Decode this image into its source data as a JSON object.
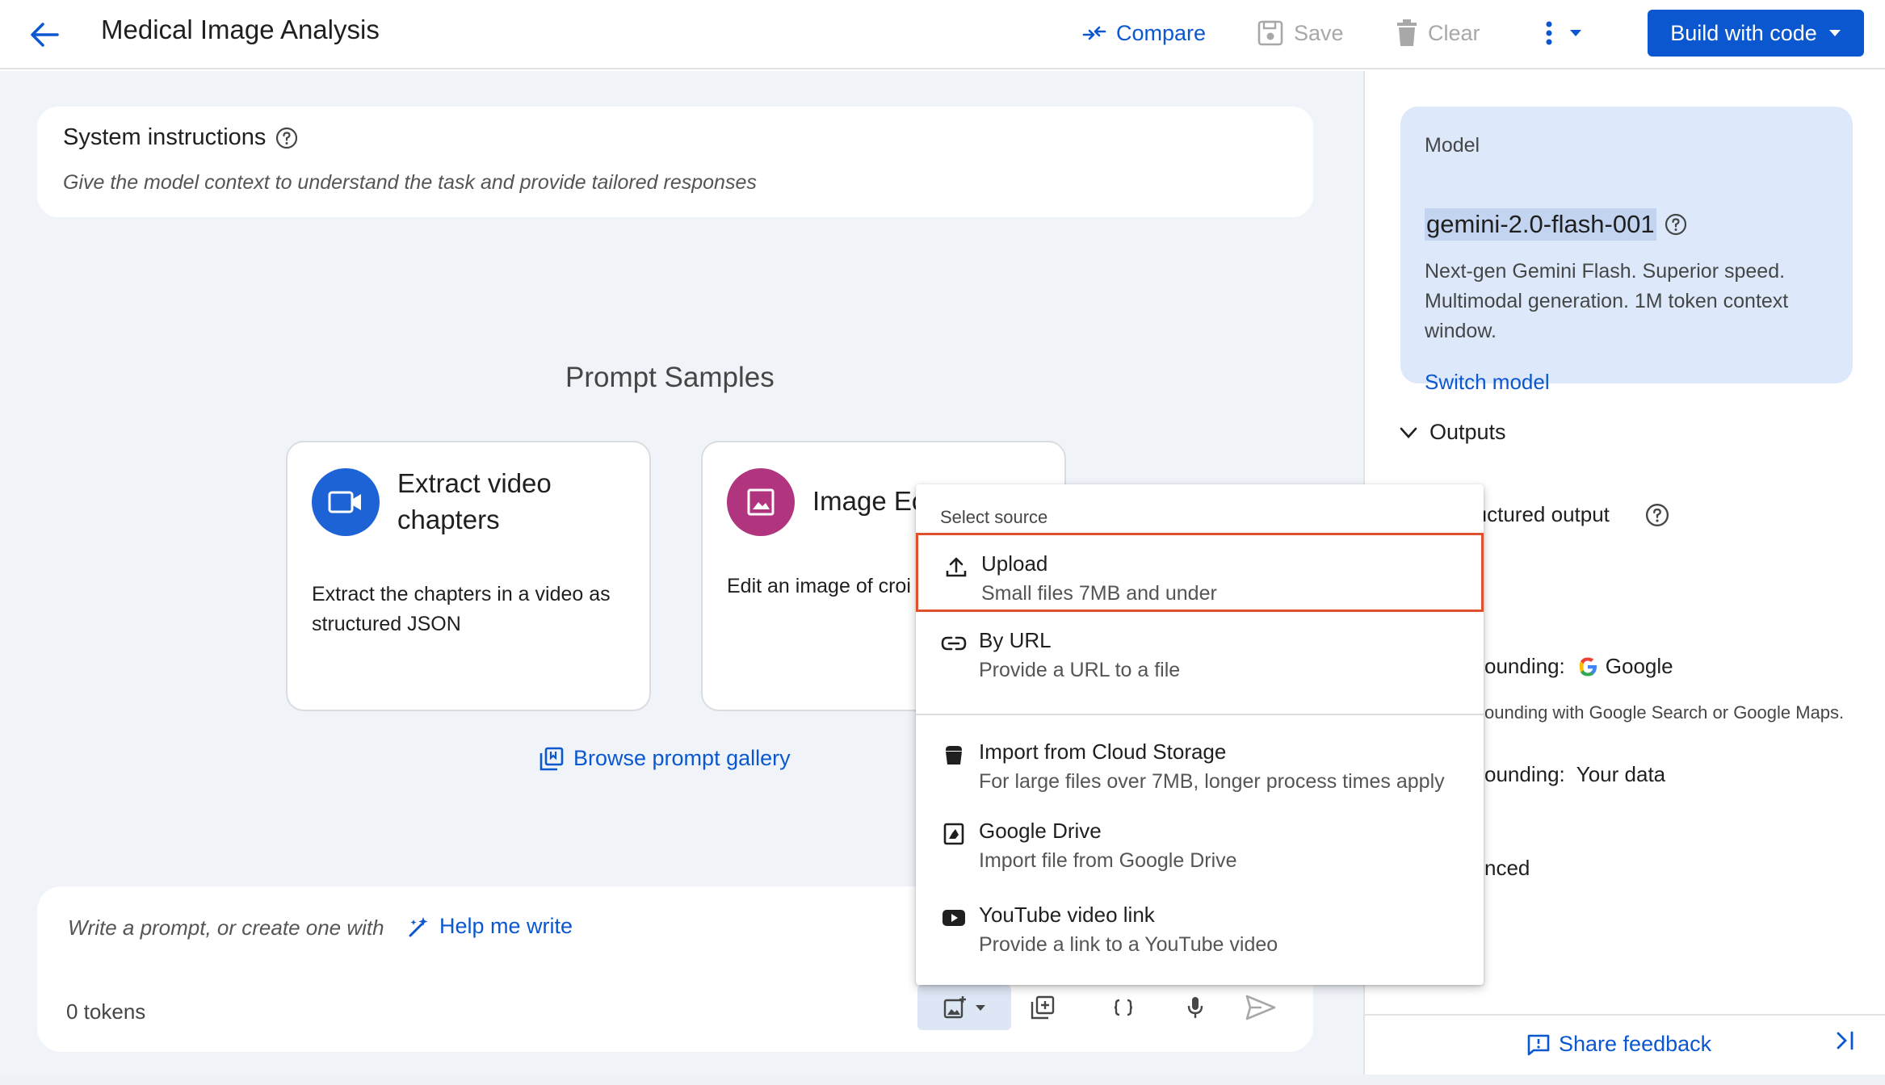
{
  "header": {
    "title": "Medical Image Analysis",
    "compare_label": "Compare",
    "save_label": "Save",
    "clear_label": "Clear",
    "build_label": "Build with code"
  },
  "system_instructions": {
    "title": "System instructions",
    "placeholder": "Give the model context to understand the task and provide tailored responses"
  },
  "samples": {
    "title": "Prompt Samples",
    "cards": [
      {
        "title": "Extract video chapters",
        "description": "Extract the chapters in a video as structured JSON",
        "icon": "video-camera-icon"
      },
      {
        "title": "Image Ec",
        "description": "Edit an image of croi",
        "icon": "image-icon"
      }
    ],
    "browse_label": "Browse prompt gallery"
  },
  "prompt": {
    "placeholder": "Write a prompt, or create one with",
    "help_label": "Help me write",
    "tokens": "0 tokens"
  },
  "side": {
    "model_label": "Model",
    "model_name": "gemini-2.0-flash-001",
    "model_description": "Next-gen Gemini Flash. Superior speed. Multimodal generation. 1M token context window.",
    "switch_label": "Switch model",
    "outputs_label": "Outputs",
    "structured_output": "ructured output",
    "grounding_google_prefix": "ounding:",
    "grounding_google": "Google",
    "grounding_desc": "ounding with Google Search or Google Maps.",
    "grounding_data_prefix": "ounding:",
    "grounding_data": "Your data",
    "advanced": "nced",
    "share_feedback": "Share feedback",
    "collapse": ">|"
  },
  "menu": {
    "header": "Select source",
    "items": [
      {
        "label": "Upload",
        "sub": "Small files 7MB and under",
        "icon": "upload-icon"
      },
      {
        "label": "By URL",
        "sub": "Provide a URL to a file",
        "icon": "link-icon"
      },
      {
        "label": "Import from Cloud Storage",
        "sub": "For large files over 7MB, longer process times apply",
        "icon": "cloud-storage-icon"
      },
      {
        "label": "Google Drive",
        "sub": "Import file from Google Drive",
        "icon": "google-drive-icon"
      },
      {
        "label": "YouTube video link",
        "sub": "Provide a link to a YouTube video",
        "icon": "youtube-icon"
      }
    ]
  },
  "colors": {
    "accent": "#0b57d0",
    "highlight": "#e0502e",
    "model_card_bg": "#dde9fb"
  }
}
